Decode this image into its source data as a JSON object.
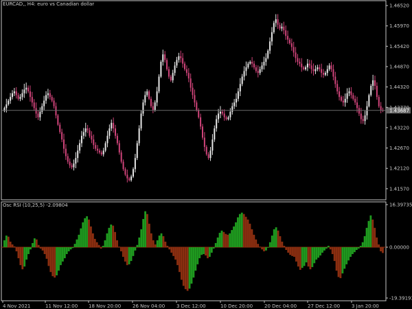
{
  "colors": {
    "background": "#000000",
    "frame": "#c8c8c8",
    "text": "#c8c8c8",
    "candle_bull": "#e8e8e8",
    "candle_bear": "#d0447a",
    "price_line": "#6a6a6a",
    "price_tag_bg": "#6a6a6a",
    "osc_up": "#1f9a1f",
    "osc_down": "#8b2e10",
    "zero_line": "#8b2e10"
  },
  "main_panel": {
    "title": "EURCAD,, H4:  euro vs Canadian dollar",
    "current_price": "1.43687",
    "price_axis": [
      "1.46520",
      "1.45970",
      "1.45420",
      "1.44870",
      "1.44320",
      "1.43770",
      "1.43220",
      "1.42670",
      "1.42120",
      "1.41570"
    ],
    "ylim": [
      1.4127,
      1.4667
    ]
  },
  "indicator_panel": {
    "title": "Osc RSI (10,25,5) -2.09804",
    "axis_labels": [
      "16.39735",
      "0.00000",
      "-19.39193"
    ],
    "ylim": [
      -19.39193,
      16.39735
    ]
  },
  "time_axis": [
    "4 Nov 2021",
    "11 Nov 12:00",
    "18 Nov 20:00",
    "26 Nov 04:00",
    "3 Dec 12:00",
    "10 Dec 20:00",
    "20 Dec 04:00",
    "27 Dec 12:00",
    "3 Jan 20:00"
  ],
  "chart_data": [
    {
      "type": "candlestick",
      "title": "EURCAD,, H4:  euro vs Canadian dollar",
      "ylim": [
        1.4127,
        1.4667
      ],
      "close": [
        1.4375,
        1.4385,
        1.4395,
        1.4405,
        1.4415,
        1.442,
        1.441,
        1.44,
        1.4405,
        1.4415,
        1.4425,
        1.443,
        1.442,
        1.4405,
        1.439,
        1.4375,
        1.436,
        1.435,
        1.4365,
        1.438,
        1.4395,
        1.441,
        1.4415,
        1.4405,
        1.4395,
        1.438,
        1.4355,
        1.433,
        1.431,
        1.429,
        1.4265,
        1.4245,
        1.423,
        1.422,
        1.4215,
        1.4225,
        1.424,
        1.426,
        1.428,
        1.43,
        1.431,
        1.432,
        1.4315,
        1.43,
        1.429,
        1.4275,
        1.4265,
        1.426,
        1.4255,
        1.425,
        1.426,
        1.428,
        1.43,
        1.432,
        1.4335,
        1.432,
        1.43,
        1.428,
        1.4255,
        1.423,
        1.421,
        1.4195,
        1.4185,
        1.418,
        1.419,
        1.421,
        1.424,
        1.428,
        1.432,
        1.436,
        1.439,
        1.441,
        1.442,
        1.44,
        1.438,
        1.437,
        1.439,
        1.442,
        1.446,
        1.45,
        1.452,
        1.4505,
        1.448,
        1.446,
        1.445,
        1.447,
        1.449,
        1.4505,
        1.4515,
        1.451,
        1.4495,
        1.448,
        1.447,
        1.4455,
        1.443,
        1.441,
        1.439,
        1.437,
        1.435,
        1.4325,
        1.4295,
        1.427,
        1.425,
        1.424,
        1.426,
        1.429,
        1.432,
        1.4345,
        1.436,
        1.4365,
        1.436,
        1.435,
        1.4345,
        1.435,
        1.4365,
        1.438,
        1.439,
        1.44,
        1.442,
        1.444,
        1.446,
        1.4475,
        1.4485,
        1.4495,
        1.45,
        1.4495,
        1.4485,
        1.4475,
        1.447,
        1.448,
        1.449,
        1.45,
        1.451,
        1.453,
        1.4555,
        1.458,
        1.4605,
        1.4615,
        1.46,
        1.459,
        1.4595,
        1.4585,
        1.457,
        1.456,
        1.455,
        1.454,
        1.4525,
        1.451,
        1.45,
        1.4495,
        1.4485,
        1.448,
        1.4485,
        1.4495,
        1.449,
        1.448,
        1.4475,
        1.448,
        1.4485,
        1.448,
        1.447,
        1.4465,
        1.447,
        1.448,
        1.449,
        1.448,
        1.446,
        1.444,
        1.442,
        1.4405,
        1.4395,
        1.439,
        1.44,
        1.4415,
        1.442,
        1.441,
        1.44,
        1.439,
        1.4375,
        1.436,
        1.4345,
        1.434,
        1.4355,
        1.438,
        1.441,
        1.4435,
        1.445,
        1.4435,
        1.4405,
        1.438,
        1.437,
        1.4369
      ]
    },
    {
      "type": "bar",
      "title": "Osc RSI (10,25,5) -2.09804",
      "ylim": [
        -19.39193,
        16.39735
      ],
      "values": [
        2.5,
        4.2,
        3.8,
        2.0,
        1.0,
        0.3,
        -1.5,
        -4.0,
        -6.5,
        -8.0,
        -7.0,
        -4.5,
        -2.5,
        -0.8,
        1.5,
        3.2,
        2.8,
        0.8,
        -0.5,
        -1.2,
        -2.5,
        -4.2,
        -6.8,
        -9.0,
        -10.5,
        -11.0,
        -10.2,
        -8.5,
        -6.5,
        -5.2,
        -4.0,
        -2.5,
        -1.5,
        -0.8,
        -0.3,
        1.2,
        2.8,
        4.5,
        6.8,
        9.0,
        10.5,
        11.2,
        10.0,
        7.5,
        5.0,
        3.0,
        1.8,
        0.8,
        -0.5,
        0.5,
        2.5,
        5.0,
        7.0,
        8.2,
        7.8,
        5.5,
        2.5,
        0.2,
        -1.5,
        -3.5,
        -5.2,
        -6.5,
        -6.2,
        -5.0,
        -3.2,
        -1.2,
        0.8,
        3.5,
        6.5,
        10.2,
        13.0,
        12.0,
        8.5,
        5.0,
        2.5,
        1.0,
        2.5,
        4.2,
        5.0,
        4.0,
        2.0,
        0.5,
        -0.8,
        -2.0,
        -3.2,
        -4.5,
        -6.5,
        -9.0,
        -11.8,
        -14.0,
        -15.2,
        -15.8,
        -15.0,
        -13.2,
        -11.0,
        -8.5,
        -6.2,
        -4.0,
        -2.8,
        -2.5,
        -3.0,
        -4.0,
        -3.5,
        -2.0,
        -0.5,
        1.5,
        3.5,
        5.2,
        6.0,
        5.5,
        4.8,
        4.5,
        5.0,
        6.2,
        7.5,
        9.0,
        10.8,
        12.0,
        12.5,
        12.0,
        11.0,
        10.0,
        8.5,
        6.5,
        4.5,
        2.8,
        1.2,
        0.2,
        -0.8,
        -1.5,
        -1.2,
        -0.2,
        1.8,
        4.2,
        6.5,
        7.2,
        6.0,
        4.0,
        2.0,
        0.5,
        -1.0,
        -2.0,
        -2.8,
        -3.2,
        -3.5,
        -5.2,
        -7.0,
        -8.2,
        -7.5,
        -6.8,
        -5.5,
        -7.0,
        -8.0,
        -7.2,
        -5.8,
        -4.5,
        -3.8,
        -3.0,
        -2.0,
        -1.2,
        -0.5,
        0.5,
        -0.8,
        -2.5,
        -5.0,
        -8.5,
        -10.8,
        -11.2,
        -9.5,
        -7.8,
        -6.2,
        -4.8,
        -3.5,
        -2.5,
        -1.8,
        -1.0,
        -0.5,
        0.5,
        1.8,
        4.0,
        7.0,
        9.5,
        11.5,
        10.0,
        7.0,
        3.5,
        1.0,
        -1.5,
        -2.1
      ]
    }
  ]
}
